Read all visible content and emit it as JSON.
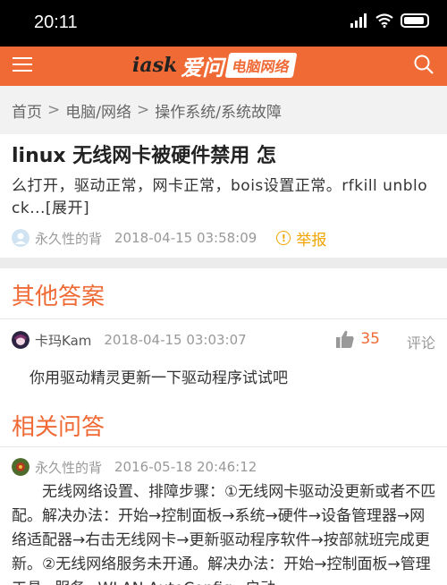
{
  "status_bar": {
    "time": "20:11"
  },
  "header": {
    "logo_mark": "iask",
    "logo_brand": "爱问",
    "logo_sub": "电脑网络"
  },
  "breadcrumb": {
    "items": [
      "首页",
      "电脑/网络",
      "操作系统/系统故障"
    ],
    "separator": ">"
  },
  "question": {
    "title": "linux 无线网卡被硬件禁用 怎",
    "body": "么打开，驱动正常，网卡正常，bois设置正常。rfkill unblock...[展开]",
    "user": "永久性的背",
    "time": "2018-04-15 03:58:09",
    "report_label": "举报"
  },
  "other_answers": {
    "title": "其他答案",
    "items": [
      {
        "user": "卡玛Kam",
        "time": "2018-04-15 03:03:07",
        "likes": "35",
        "comment_label": "评论",
        "text": "你用驱动精灵更新一下驱动程序试试吧"
      }
    ]
  },
  "related": {
    "title": "相关问答",
    "user": "永久性的背",
    "time": "2016-05-18 20:46:12",
    "text": "无线网络设置、排障步骤：①无线网卡驱动没更新或者不匹配。解决办法：开始→控制面板→系统→硬件→设备管理器→网络适配器→右击无线网卡→更新驱动程序软件→按部就班完成更新。②无线网络服务未开通。解决办法：开始→控制面板→管理工具→服务→WLAN AutoConfig→启动"
  },
  "colors": {
    "accent": "#f06a35",
    "report": "#f0a500"
  }
}
